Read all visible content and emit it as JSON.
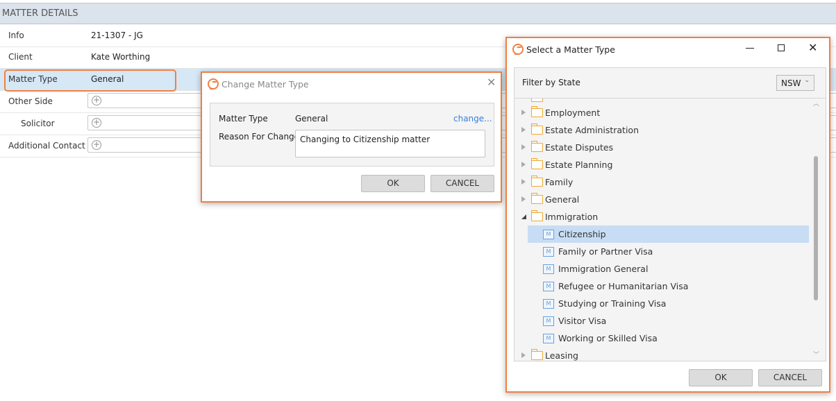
{
  "matter_details": {
    "header": "MATTER DETAILS",
    "rows": [
      {
        "label": "Info",
        "value": "21-1307 - JG"
      },
      {
        "label": "Client",
        "value": "Kate Worthing"
      },
      {
        "label": "Matter Type",
        "value": "General"
      },
      {
        "label": "Other Side",
        "value": ""
      },
      {
        "label": "Solicitor",
        "value": ""
      },
      {
        "label": "Additional Contact",
        "value": ""
      }
    ]
  },
  "change_dialog": {
    "title": "Change Matter Type",
    "matter_type_label": "Matter Type",
    "matter_type_value": "General",
    "change_link": "change...",
    "reason_label": "Reason For Change",
    "reason_value": "Changing to Citizenship matter",
    "ok": "OK",
    "cancel": "CANCEL"
  },
  "select_dialog": {
    "title": "Select a Matter Type",
    "filter_label": "Filter by State",
    "filter_value": "NSW",
    "tree": [
      {
        "label": "Employment",
        "type": "folder",
        "expanded": false
      },
      {
        "label": "Estate Administration",
        "type": "folder",
        "expanded": false
      },
      {
        "label": "Estate Disputes",
        "type": "folder",
        "expanded": false
      },
      {
        "label": "Estate Planning",
        "type": "folder",
        "expanded": false
      },
      {
        "label": "Family",
        "type": "folder",
        "expanded": false
      },
      {
        "label": "General",
        "type": "folder",
        "expanded": false
      },
      {
        "label": "Immigration",
        "type": "folder",
        "expanded": true
      },
      {
        "label": "Citizenship",
        "type": "matter",
        "selected": true
      },
      {
        "label": "Family or Partner Visa",
        "type": "matter"
      },
      {
        "label": "Immigration General",
        "type": "matter"
      },
      {
        "label": "Refugee or Humanitarian Visa",
        "type": "matter"
      },
      {
        "label": "Studying or Training Visa",
        "type": "matter"
      },
      {
        "label": "Visitor Visa",
        "type": "matter"
      },
      {
        "label": "Working or Skilled Visa",
        "type": "matter"
      },
      {
        "label": "Leasing",
        "type": "folder",
        "expanded": false
      }
    ],
    "ok": "OK",
    "cancel": "CANCEL"
  },
  "colors": {
    "accent": "#f08040",
    "selection": "#c7ddf4",
    "link": "#3a7fd5",
    "folder": "#f0a830"
  }
}
